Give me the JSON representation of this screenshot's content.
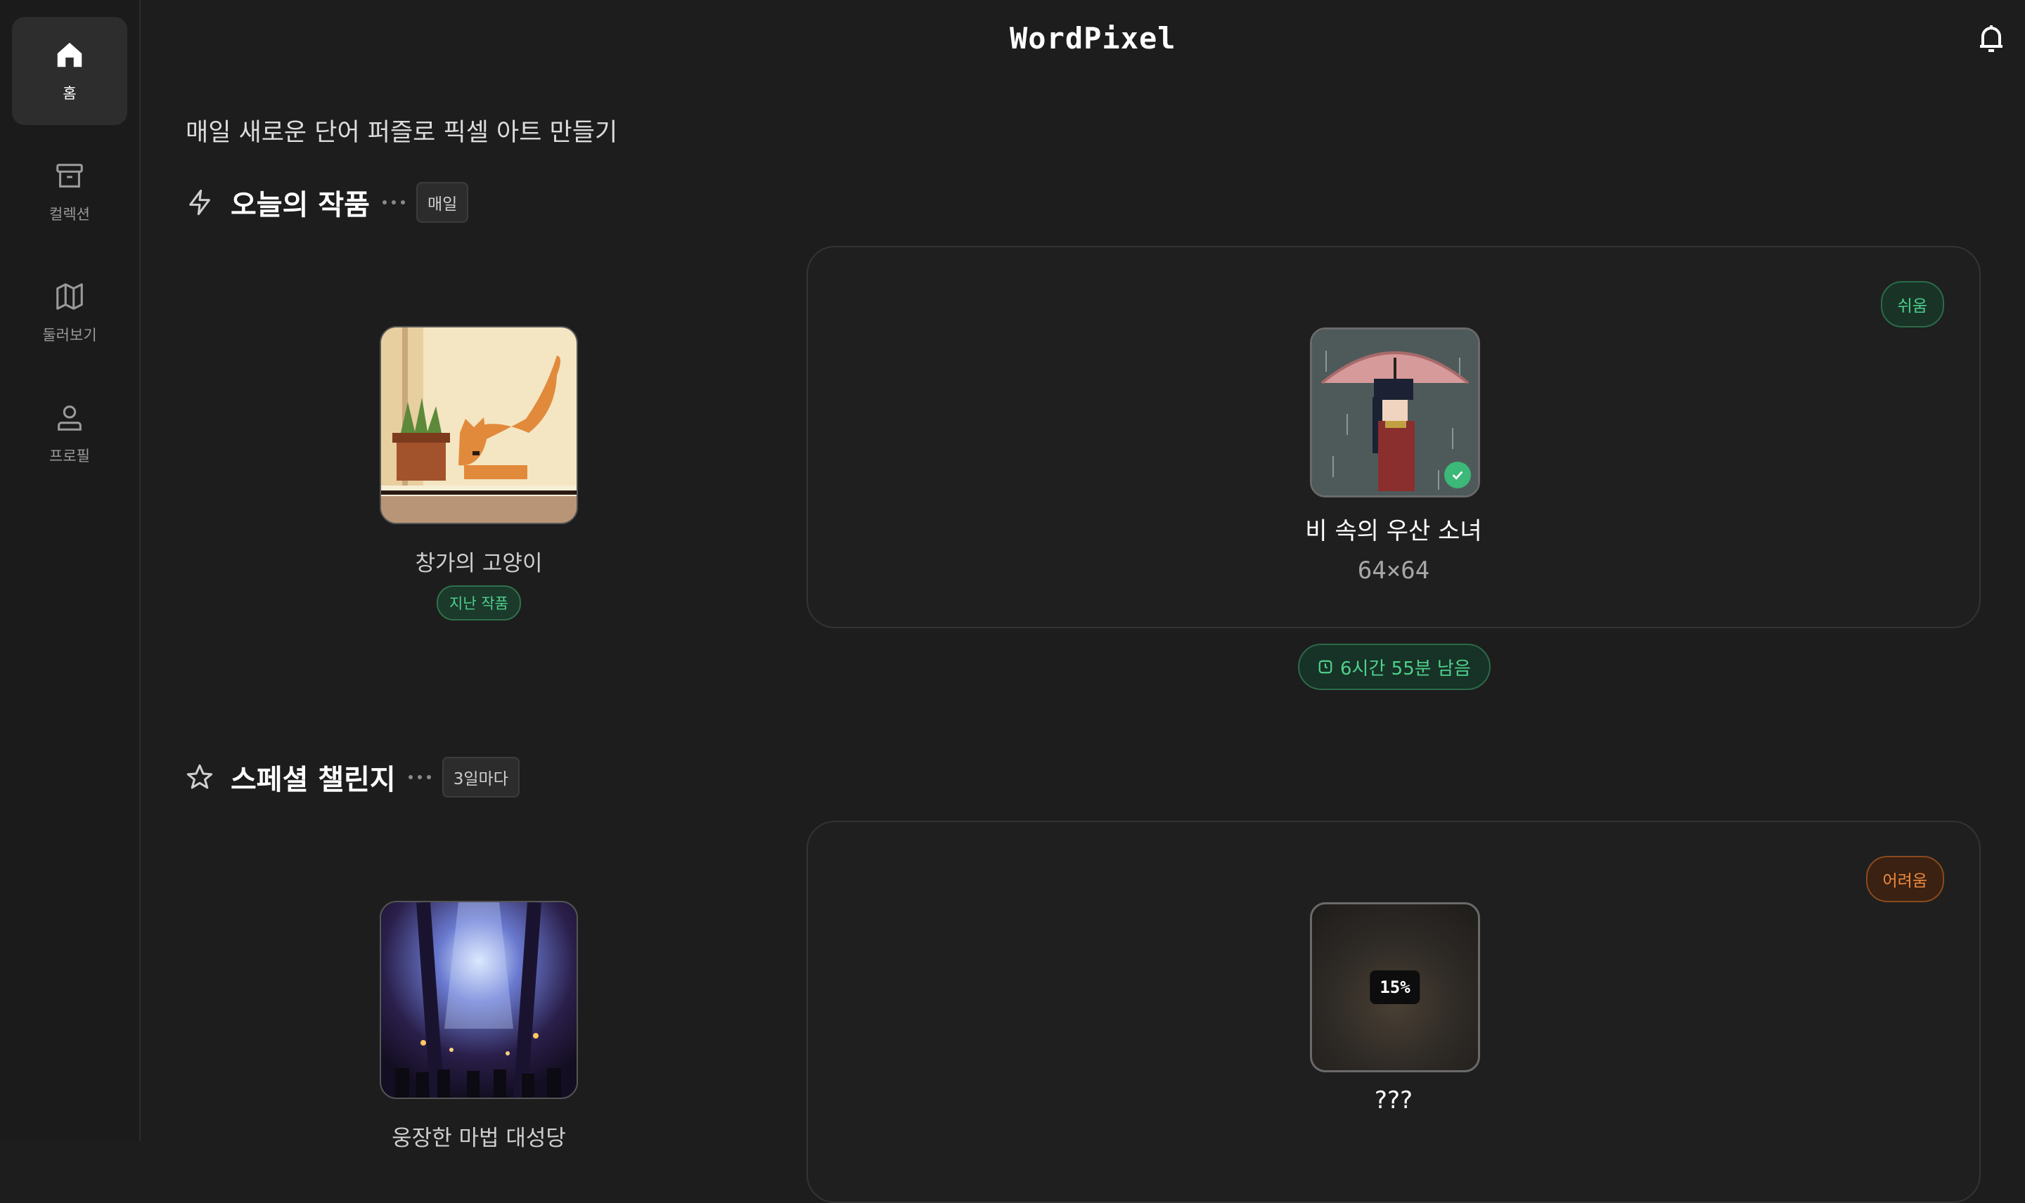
{
  "app": {
    "title": "WordPixel",
    "tagline": "매일 새로운 단어 퍼즐로 픽셀 아트 만들기"
  },
  "sidebar": {
    "items": [
      {
        "label": "홈",
        "icon": "home-icon",
        "active": true
      },
      {
        "label": "컬렉션",
        "icon": "archive-icon",
        "active": false
      },
      {
        "label": "둘러보기",
        "icon": "map-icon",
        "active": false
      },
      {
        "label": "프로필",
        "icon": "user-icon",
        "active": false
      }
    ]
  },
  "header": {
    "notification_icon": "bell-icon"
  },
  "daily": {
    "icon": "lightning-icon",
    "title": "오늘의 작품",
    "badge": "매일",
    "past": {
      "caption": "창가의 고양이",
      "badge": "지난 작품"
    },
    "current": {
      "difficulty": "쉬움",
      "title": "비 속의 우산 소녀",
      "size": "64×64",
      "completed": true
    },
    "timer": "6시간 55분 남음"
  },
  "special": {
    "icon": "star-icon",
    "title": "스페셜 챌린지",
    "badge": "3일마다",
    "past": {
      "caption": "웅장한 마법 대성당"
    },
    "current": {
      "difficulty": "어려움",
      "title": "???",
      "progress": "15%",
      "progress_value": 0.15
    }
  },
  "colors": {
    "accent_green": "#4fd08d",
    "accent_orange": "#f08a3c",
    "background": "#1d1d1d"
  }
}
